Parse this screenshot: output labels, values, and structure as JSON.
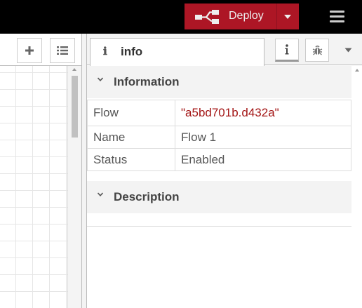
{
  "header": {
    "deploy_label": "Deploy",
    "accent_color": "#ad1625"
  },
  "workspace": {
    "add_icon": "plus-icon",
    "list_icon": "list-icon"
  },
  "sidebar": {
    "active_tab": {
      "icon": "ℹ",
      "label": "info"
    },
    "info_section": {
      "title": "Information",
      "rows": [
        {
          "key": "Flow",
          "value": "\"a5bd701b.d432a\""
        },
        {
          "key": "Name",
          "value": "Flow 1"
        },
        {
          "key": "Status",
          "value": "Enabled"
        }
      ]
    },
    "description_section": {
      "title": "Description"
    }
  }
}
